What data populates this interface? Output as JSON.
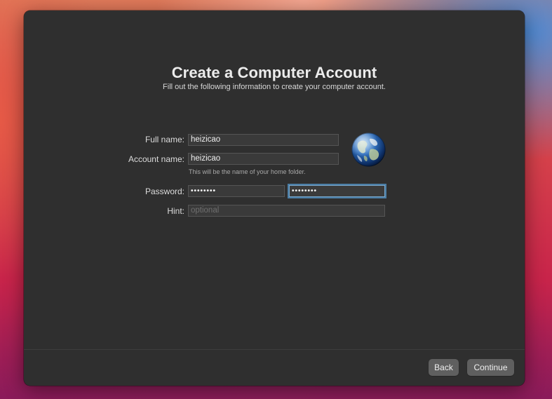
{
  "window": {
    "title": "Create a Computer Account",
    "subtitle": "Fill out the following information to create your computer account."
  },
  "form": {
    "full_name": {
      "label": "Full name:",
      "value": "heizicao"
    },
    "account_name": {
      "label": "Account name:",
      "value": "heizicao",
      "help": "This will be the name of your home folder."
    },
    "password": {
      "label": "Password:",
      "value": "••••••••",
      "verify_value": "••••••••"
    },
    "hint": {
      "label": "Hint:",
      "placeholder": "optional"
    },
    "avatar_icon": "globe-icon"
  },
  "footer": {
    "back_label": "Back",
    "continue_label": "Continue"
  },
  "colors": {
    "window_bg": "#2f2f2f",
    "focus_ring": "#4b7ea6",
    "button_bg": "#5f5f5f"
  }
}
